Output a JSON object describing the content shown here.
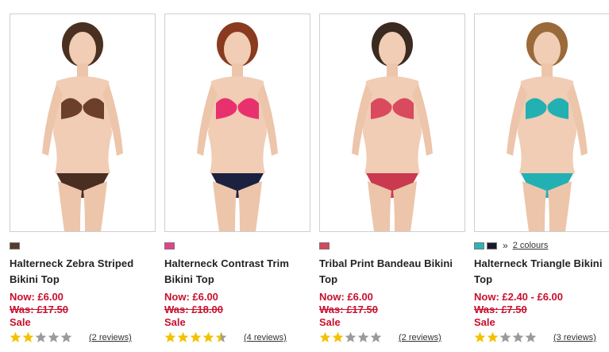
{
  "products": [
    {
      "name": "Halterneck Zebra Striped Bikini Top",
      "now": "Now: £6.00",
      "was": "Was: £17.50",
      "sale": "Sale",
      "rating": 2,
      "reviews": "(2 reviews)",
      "swatches": [
        "#5a3a2e"
      ],
      "colours_link": "",
      "colors": {
        "top": "#6b3f2a",
        "bottom": "#4a2e22",
        "hair": "#4a3020"
      }
    },
    {
      "name": "Halterneck Contrast Trim Bikini Top",
      "now": "Now: £6.00",
      "was": "Was: £18.00",
      "sale": "Sale",
      "rating": 4.5,
      "reviews": "(4 reviews)",
      "swatches": [
        "#e8408a"
      ],
      "colours_link": "",
      "colors": {
        "top": "#e8306e",
        "bottom": "#1c2140",
        "hair": "#8a3a1f"
      }
    },
    {
      "name": "Tribal Print Bandeau Bikini Top",
      "now": "Now: £6.00",
      "was": "Was: £17.50",
      "sale": "Sale",
      "rating": 2,
      "reviews": "(2 reviews)",
      "swatches": [
        "#d9455a"
      ],
      "colours_link": "",
      "colors": {
        "top": "#d94a5e",
        "bottom": "#c93a4f",
        "hair": "#3a2a20"
      }
    },
    {
      "name": "Halterneck Triangle Bikini Top",
      "now": "Now: £2.40 - £6.00",
      "was": "Was: £7.50",
      "sale": "Sale",
      "rating": 2,
      "reviews": "(3 reviews)",
      "swatches": [
        "#2bb5b8",
        "#1a1a2a"
      ],
      "more_symbol": "»",
      "colours_link": "2 colours",
      "colors": {
        "top": "#23b0b2",
        "bottom": "#23b0b2",
        "hair": "#9a6a3a"
      }
    }
  ],
  "theme": {
    "price_color": "#c8102e",
    "star_fill": "#f2c200",
    "star_empty": "#9a9a9a"
  }
}
